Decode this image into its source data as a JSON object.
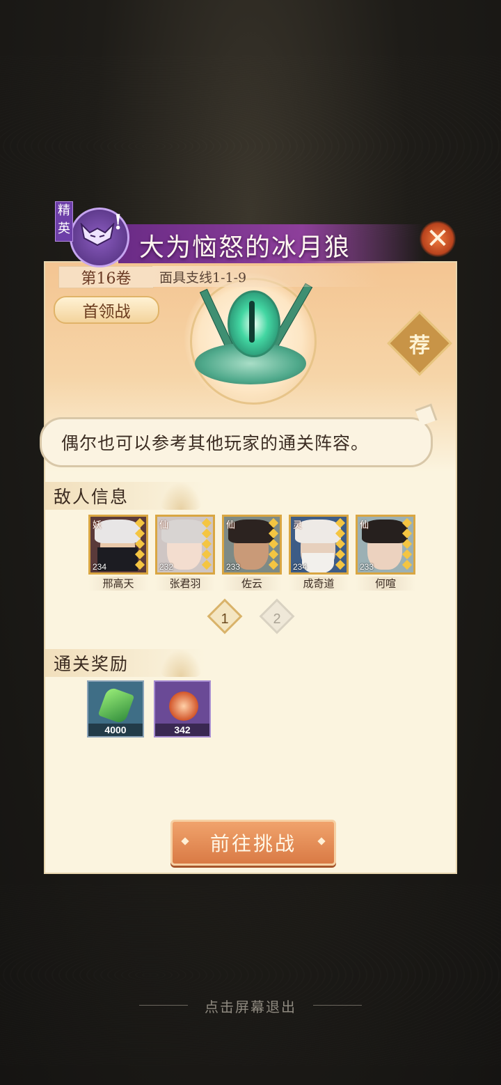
{
  "header": {
    "difficulty_badge": "精英",
    "stage_title": "大为恼怒的冰月狼",
    "close_icon": "close-x-icon"
  },
  "stage": {
    "volume": "第16卷",
    "branch": "面具支线1-1-9",
    "battle_type": "首领战",
    "recommend_badge": "荐"
  },
  "tip": "偶尔也可以参考其他玩家的通关阵容。",
  "enemy_section": {
    "title": "敌人信息",
    "enemies": [
      {
        "name": "邢高天",
        "faction": "妖",
        "level": "234",
        "stars": 5,
        "color": "#2b2b33"
      },
      {
        "name": "张君羽",
        "faction": "仙",
        "level": "232",
        "stars": 5,
        "color": "#d6d3d0"
      },
      {
        "name": "佐云",
        "faction": "仙",
        "level": "233",
        "stars": 5,
        "color": "#2c2320"
      },
      {
        "name": "成奇道",
        "faction": "灵",
        "level": "234",
        "stars": 5,
        "color": "#e8e6e2"
      },
      {
        "name": "何喧",
        "faction": "仙",
        "level": "233",
        "stars": 5,
        "color": "#26201e"
      }
    ],
    "pages": [
      "1",
      "2"
    ],
    "active_page": "1"
  },
  "reward_section": {
    "title": "通关奖励",
    "rewards": [
      {
        "item": "green-crystal-icon",
        "quantity": "4000",
        "bg": "#3f6e86"
      },
      {
        "item": "orange-orb-icon",
        "quantity": "342",
        "bg": "#6a4a96"
      }
    ]
  },
  "actions": {
    "challenge_button": "前往挑战",
    "exit_hint": "点击屏幕退出"
  }
}
